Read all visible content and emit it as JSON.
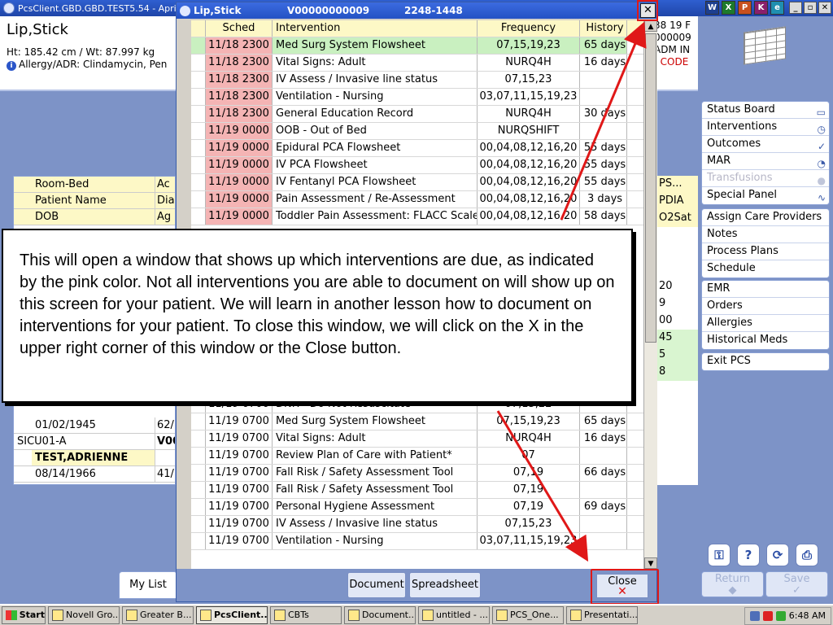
{
  "app": {
    "title": "PcsClient.GBD.GBD.TEST5.54 - April",
    "controls": [
      "_",
      "▫",
      "✕"
    ]
  },
  "patient": {
    "name": "Lip,Stick",
    "htwt": "Ht: 185.42 cm / Wt: 87.997 kg",
    "allergy": "Allergy/ADR: Clindamycin, Pen",
    "right_lines": [
      "38 19 F",
      "000009",
      "ADM IN",
      ". CODE"
    ]
  },
  "nav": {
    "group1": [
      {
        "label": "Status Board",
        "icon": "book-icon",
        "enabled": true
      },
      {
        "label": "Interventions",
        "icon": "clock-icon",
        "enabled": true
      },
      {
        "label": "Outcomes",
        "icon": "check-icon",
        "enabled": true
      },
      {
        "label": "MAR",
        "icon": "pill-icon",
        "enabled": true
      },
      {
        "label": "Transfusions",
        "icon": "drop-icon",
        "enabled": false
      },
      {
        "label": "Special Panel",
        "icon": "pulse-icon",
        "enabled": true
      }
    ],
    "group2": [
      "Assign Care Providers",
      "Notes",
      "Process Plans",
      "Schedule"
    ],
    "group3": [
      "EMR",
      "Orders",
      "Allergies",
      "Historical Meds"
    ],
    "group4": [
      "Exit PCS"
    ],
    "return_label": "Return",
    "save_label": "Save"
  },
  "bg_table": {
    "headers": [
      {
        "c1": "Room-Bed",
        "c2": "Ac"
      },
      {
        "c1": "Patient Name",
        "c2": "Dia"
      },
      {
        "c1": "DOB",
        "c2": "Ag"
      }
    ],
    "rows": [
      {
        "c1": "01/02/1945",
        "c2": "62/"
      },
      {
        "c1": "SICU01-A",
        "c2": "V00"
      },
      {
        "c1": "TEST,ADRIENNE",
        "c2": ""
      },
      {
        "c1": "08/14/1966",
        "c2": "41/"
      }
    ],
    "right_col": [
      "PS...",
      "PDIA",
      "O2Sat",
      "",
      "",
      "",
      "20",
      "9",
      "00",
      "45",
      "5",
      "8"
    ]
  },
  "bottom": {
    "mylist_label": "My List"
  },
  "dialog": {
    "title_name": "Lip,Stick",
    "title_account": "V00000000009",
    "title_room": "2248-1448",
    "close_glyph": "✕",
    "columns": [
      "Sched",
      "Intervention",
      "Frequency",
      "History"
    ],
    "rows_top": [
      {
        "sched": "11/18 2300",
        "intervention": "Med Surg System Flowsheet",
        "frequency": "07,15,19,23",
        "history": "65 days",
        "due": true,
        "selected": true
      },
      {
        "sched": "11/18 2300",
        "intervention": "Vital Signs: Adult",
        "frequency": "NURQ4H",
        "history": "16 days",
        "due": true
      },
      {
        "sched": "11/18 2300",
        "intervention": "IV Assess / Invasive line status",
        "frequency": "07,15,23",
        "history": "",
        "due": true
      },
      {
        "sched": "11/18 2300",
        "intervention": "Ventilation - Nursing",
        "frequency": "03,07,11,15,19,23",
        "history": "",
        "due": true
      },
      {
        "sched": "11/18 2300",
        "intervention": "General Education Record",
        "frequency": "NURQ4H",
        "history": "30 days",
        "due": true
      },
      {
        "sched": "11/19 0000",
        "intervention": "OOB - Out of Bed",
        "frequency": "NURQSHIFT",
        "history": "",
        "due": true
      },
      {
        "sched": "11/19 0000",
        "intervention": "Epidural PCA Flowsheet",
        "frequency": "00,04,08,12,16,20",
        "history": "55 days",
        "due": true
      },
      {
        "sched": "11/19 0000",
        "intervention": "IV PCA Flowsheet",
        "frequency": "00,04,08,12,16,20",
        "history": "55 days",
        "due": true
      },
      {
        "sched": "11/19 0000",
        "intervention": "IV Fentanyl PCA Flowsheet",
        "frequency": "00,04,08,12,16,20",
        "history": "55 days",
        "due": true
      },
      {
        "sched": "11/19 0000",
        "intervention": "Pain Assessment / Re-Assessment",
        "frequency": "00,04,08,12,16,20",
        "history": "3 days",
        "due": true
      },
      {
        "sched": "11/19 0000",
        "intervention": "Toddler Pain Assessment: FLACC Scale",
        "frequency": "00,04,08,12,16,20",
        "history": "58 days",
        "due": true
      }
    ],
    "rows_bottom": [
      {
        "sched": "11/19 0700",
        "intervention": "DNR - Do Not Resuscitate",
        "frequency": "07,15,22",
        "history": ""
      },
      {
        "sched": "11/19 0700",
        "intervention": "Med Surg System Flowsheet",
        "frequency": "07,15,19,23",
        "history": "65 days"
      },
      {
        "sched": "11/19 0700",
        "intervention": "Vital Signs: Adult",
        "frequency": "NURQ4H",
        "history": "16 days"
      },
      {
        "sched": "11/19 0700",
        "intervention": "Review Plan of Care with Patient*",
        "frequency": "07",
        "history": ""
      },
      {
        "sched": "11/19 0700",
        "intervention": "Fall Risk / Safety Assessment Tool",
        "frequency": "07,19",
        "history": "66 days"
      },
      {
        "sched": "11/19 0700",
        "intervention": "Fall Risk / Safety Assessment Tool",
        "frequency": "07,19",
        "history": ""
      },
      {
        "sched": "11/19 0700",
        "intervention": "Personal Hygiene Assessment",
        "frequency": "07,19",
        "history": "69 days"
      },
      {
        "sched": "11/19 0700",
        "intervention": "IV Assess / Invasive line status",
        "frequency": "07,15,23",
        "history": ""
      },
      {
        "sched": "11/19 0700",
        "intervention": "Ventilation - Nursing",
        "frequency": "03,07,11,15,19,23",
        "history": ""
      }
    ],
    "document_label": "Document",
    "spreadsheet_label": "Spreadsheet",
    "close_label": "Close"
  },
  "callout": {
    "text": "This will open a window that shows up which interventions are due, as indicated by the pink color. Not all interventions you are able to document on will show up on this screen for your patient. We will learn in another lesson how to document on interventions for your patient. To close this window, we will click on the X in the upper right corner of this window or the Close button."
  },
  "taskbar": {
    "start": "Start",
    "tasks": [
      "Novell Gro...",
      "Greater B...",
      "PcsClient...",
      "CBTs",
      "Document...",
      "untitled - ...",
      "PCS_One...",
      "Presentati..."
    ],
    "active_index": 2,
    "clock": "6:48 AM"
  },
  "colors": {
    "due_pink": "#f4b4b4",
    "selected_green": "#c9f0c0",
    "highlight_red": "#e01818"
  }
}
